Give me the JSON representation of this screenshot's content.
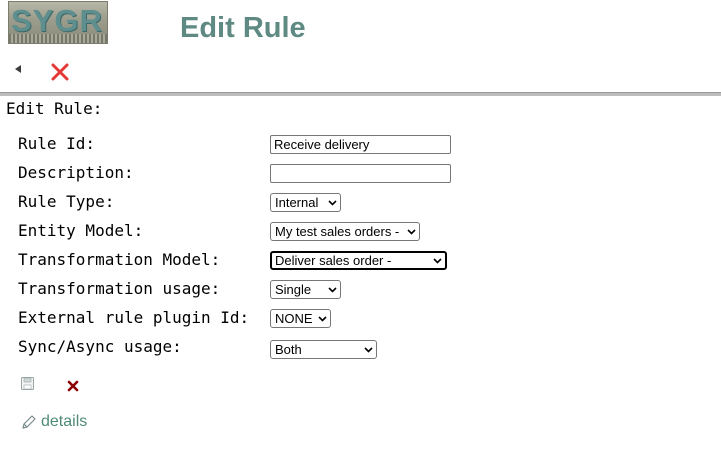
{
  "header": {
    "logo_text": "SYGR",
    "page_title": "Edit Rule"
  },
  "section_title": "Edit Rule:",
  "form": {
    "rule_id": {
      "label": "Rule Id:",
      "value": "Receive delivery"
    },
    "description": {
      "label": "Description:",
      "value": ""
    },
    "rule_type": {
      "label": "Rule Type:",
      "value": "Internal"
    },
    "entity_model": {
      "label": "Entity Model:",
      "value": "My test sales orders -"
    },
    "transformation_model": {
      "label": "Transformation Model:",
      "value": "Deliver sales order -"
    },
    "transformation_usage": {
      "label": "Transformation usage:",
      "value": "Single"
    },
    "external_plugin": {
      "label": "External rule plugin Id:",
      "value": "NONE"
    },
    "sync_async": {
      "label": "Sync/Async usage:",
      "value": "Both"
    }
  },
  "actions": {
    "details_label": "details"
  },
  "icons": {
    "back": "back-arrow-icon",
    "close_top": "close-icon",
    "save": "save-icon",
    "cancel": "cancel-icon",
    "details": "pencil-icon"
  },
  "colors": {
    "title": "#5f8a83",
    "close_red": "#e53935",
    "cancel_dark_red": "#8b0000",
    "link": "#4f8a78",
    "divider": "#bdbdbd"
  }
}
